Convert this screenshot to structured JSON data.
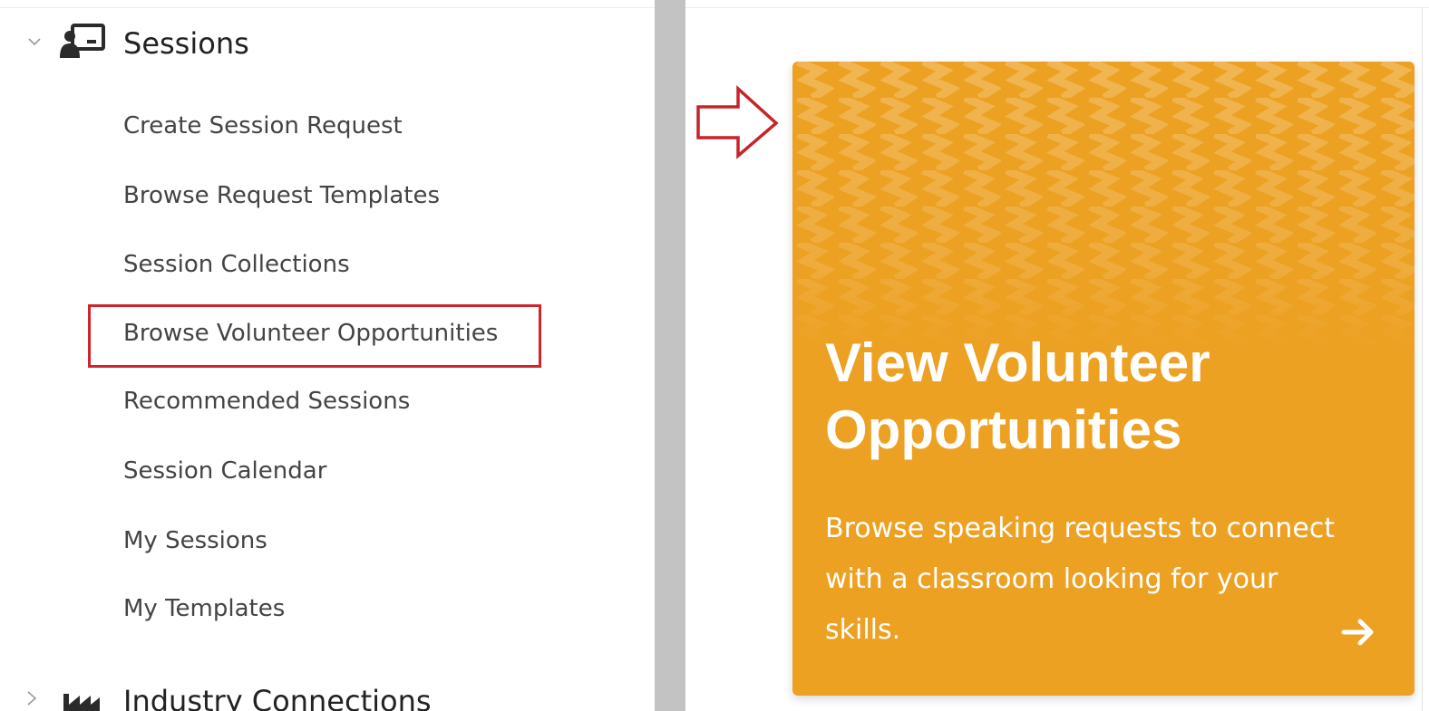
{
  "nav": {
    "group": {
      "title": "Sessions",
      "caret_icon": "chevron-down-icon",
      "icon": "presentation-icon"
    },
    "items": [
      {
        "label": "Create Session Request"
      },
      {
        "label": "Browse Request Templates"
      },
      {
        "label": "Session Collections"
      },
      {
        "label": "Browse Volunteer Opportunities",
        "highlighted": true
      },
      {
        "label": "Recommended Sessions"
      },
      {
        "label": "Session Calendar"
      },
      {
        "label": "My Sessions"
      },
      {
        "label": "My Templates"
      }
    ],
    "next_group": {
      "title": "Industry Connections",
      "caret_icon": "chevron-right-icon",
      "icon": "factory-icon"
    }
  },
  "card": {
    "title": "View Volunteer Opportunities",
    "description": "Browse speaking requests to connect with a classroom looking for your skills.",
    "arrow_icon": "arrow-right-icon",
    "pointer_icon": "callout-arrow-icon"
  },
  "colors": {
    "card_background": "#eda123",
    "highlight_border": "#d2232a",
    "divider": "#c3c3c3"
  }
}
